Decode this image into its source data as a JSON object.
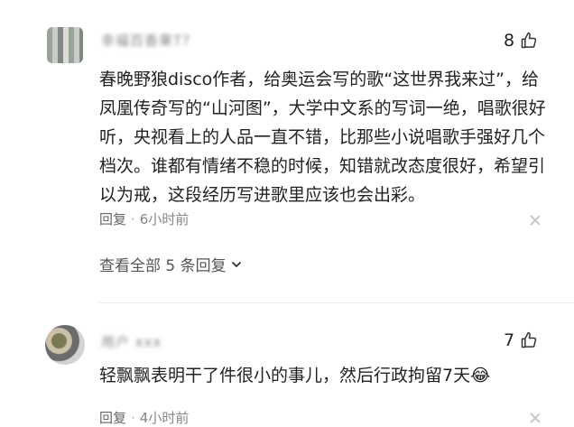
{
  "comments": [
    {
      "username": "幸福百香果T?",
      "likes": "8",
      "text": "春晚野狼disco作者，给奥运会写的歌“这世界我来过”，给凤凰传奇写的“山河图”，大学中文系的写词一绝，唱歌很好听，央视看上的人品一直不错，比那些小说唱歌手强好几个档次。谁都有情绪不稳的时候，知错就改态度很好，希望引以为戒，这段经历写进歌里应该也会出彩。",
      "reply_label": "回复",
      "time": "6小时前"
    },
    {
      "username": "用户 xxx",
      "likes": "7",
      "text": "轻飘飘表明干了件很小的事儿，然后行政拘留7天😂",
      "reply_label": "回复",
      "time": "4小时前"
    }
  ],
  "view_all_replies": "查看全部 5 条回复",
  "meta_separator": "·"
}
